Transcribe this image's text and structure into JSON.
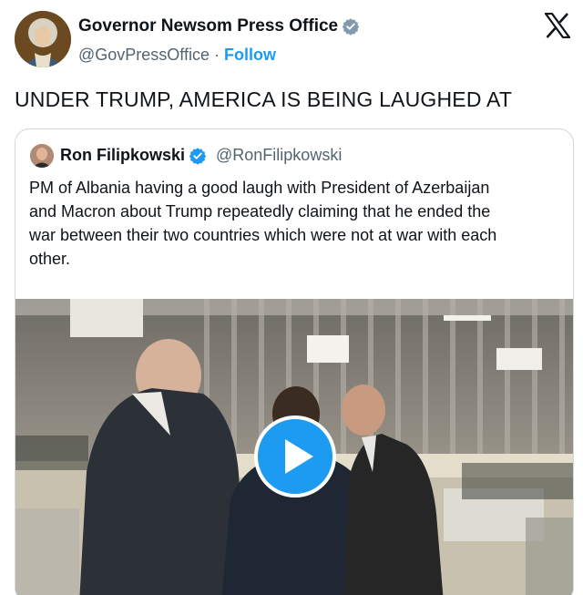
{
  "author": {
    "name": "Governor Newsom Press Office",
    "handle": "@GovPressOffice",
    "separator": "·",
    "follow_label": "Follow",
    "verified_badge_icon": "verified-badge-icon",
    "avatar_icon": "avatar-portrait-icon"
  },
  "platform_logo_icon": "x-logo-icon",
  "tweet": {
    "text": "UNDER TRUMP, AMERICA IS BEING LAUGHED AT"
  },
  "quoted_tweet": {
    "author_name": "Ron Filipkowski",
    "author_handle": "@RonFilipkowski",
    "verified_badge_icon": "verified-badge-icon",
    "text_lines": [
      "PM of Albania having a good laugh with President of Azerbaijan",
      "and Macron about Trump repeatedly claiming that he ended the",
      "war between their two countries which were not at war with each",
      "other."
    ],
    "media": {
      "kind": "video",
      "play_icon": "play-icon"
    }
  },
  "colors": {
    "accent": "#1d9bf0",
    "text_primary": "#0f1419",
    "text_secondary": "#536471",
    "border": "#cfd9de"
  }
}
